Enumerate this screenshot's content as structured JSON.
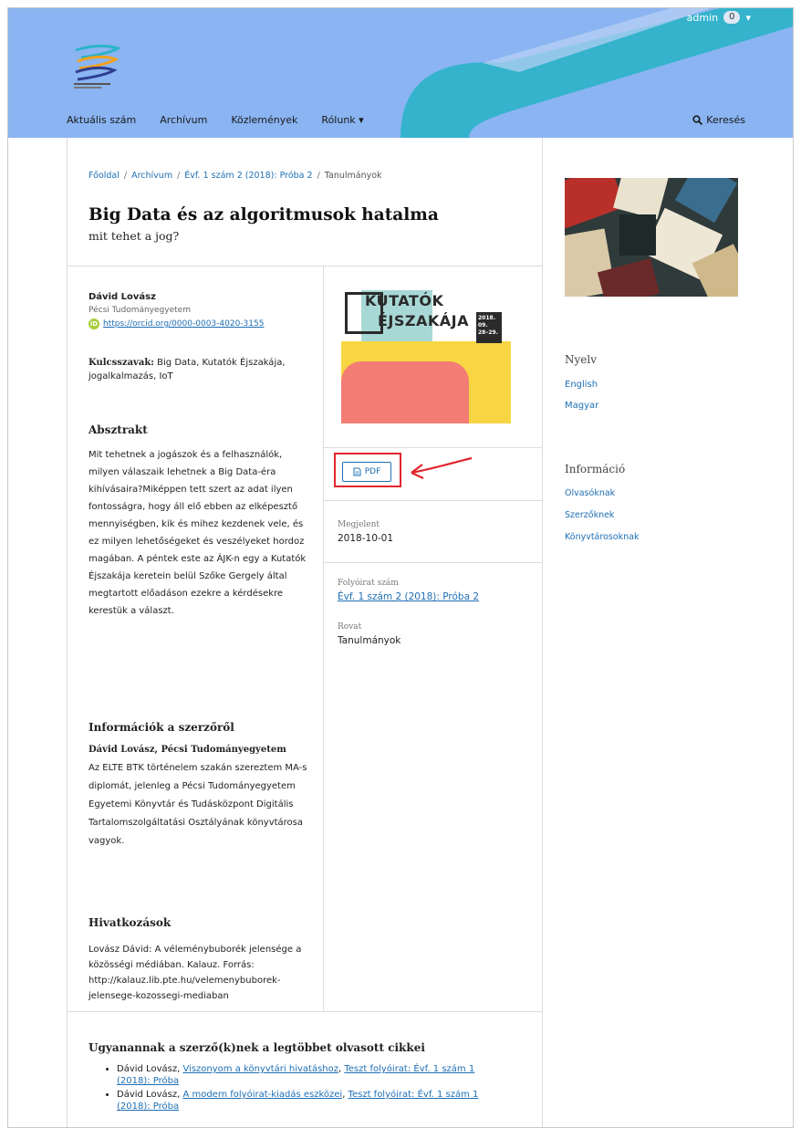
{
  "header": {
    "user_name": "admin",
    "notification_count": "0",
    "nav": [
      "Aktuális szám",
      "Archívum",
      "Közlemények",
      "Rólunk"
    ],
    "search_label": "Keresés",
    "colors": {
      "header_bg": "#8ab4f2",
      "swoosh": "#2bb3c8",
      "link": "#1e6fb5"
    }
  },
  "breadcrumb": [
    "Főoldal",
    "Archívum",
    "Évf. 1 szám 2 (2018): Próba 2",
    "Tanulmányok"
  ],
  "article": {
    "title": "Big Data és az algoritmusok hatalma",
    "subtitle": "mit tehet a jog?",
    "author_name": "Dávid Lovász",
    "author_affiliation": "Pécsi Tudományegyetem",
    "orcid": "https://orcid.org/0000-0003-4020-3155",
    "keywords_label": "Kulcsszavak:",
    "keywords": "Big Data, Kutatók Éjszakája, jogalkalmazás, IoT",
    "abstract_heading": "Absztrakt",
    "abstract": "Mit tehetnek a jogászok és a felhasználók, milyen válaszaik lehetnek a Big Data-éra kihívásaira?Miképpen tett szert az adat ilyen fontosságra, hogy áll elő ebben az elképesztő mennyiségben, kik és mihez kezdenek vele, és ez milyen lehetőségeket és veszélyeket hordoz magában. A péntek este az ÁJK-n egy a Kutatók Éjszakája keretein belül Szőke Gergely által megtartott előadáson ezekre a kérdésekre kerestük a választ.",
    "about_author_heading": "Információk a szerzőről",
    "about_author_name": "Dávid Lovász, Pécsi Tudományegyetem",
    "about_author_text": "Az ELTE BTK történelem szakán szereztem MA-s diplomát, jelenleg a Pécsi Tudományegyetem Egyetemi Könyvtár és Tudásközpont Digitális Tartalomszolgáltatási Osztályának könyvtárosa vagyok.",
    "references_heading": "Hivatkozások",
    "references": "Lovász Dávid: A véleménybuborék jelensége a közösségi médiában. Kalauz. Forrás: http://kalauz.lib.pte.hu/velemenybuborek-jelensege-kozossegi-mediaban"
  },
  "cover": {
    "line1": "KUTATÓK",
    "line2": "ÉJSZAKÁJA",
    "date": "2018. 09. 28–29."
  },
  "galley": {
    "pdf_label": "PDF"
  },
  "meta": {
    "published_label": "Megjelent",
    "published_value": "2018-10-01",
    "issue_label": "Folyóirat szám",
    "issue_value": "Évf. 1 szám 2 (2018): Próba 2",
    "section_label": "Rovat",
    "section_value": "Tanulmányok"
  },
  "most_read": {
    "heading": "Ugyanannak a szerző(k)nek a legtöbbet olvasott cikkei",
    "items": [
      {
        "author": "Dávid Lovász,",
        "title": "Viszonyom a könyvtári hivatáshoz",
        "issue": "Teszt folyóirat: Évf. 1 szám 1 (2018): Próba"
      },
      {
        "author": "Dávid Lovász,",
        "title": "A modern folyóirat-kiadás eszközei",
        "issue": "Teszt folyóirat: Évf. 1 szám 1 (2018): Próba"
      }
    ]
  },
  "sidebar": {
    "language_heading": "Nyelv",
    "languages": [
      "English",
      "Magyar"
    ],
    "info_heading": "Információ",
    "info_links": [
      "Olvasóknak",
      "Szerzőknek",
      "Könyvtárosoknak"
    ]
  }
}
